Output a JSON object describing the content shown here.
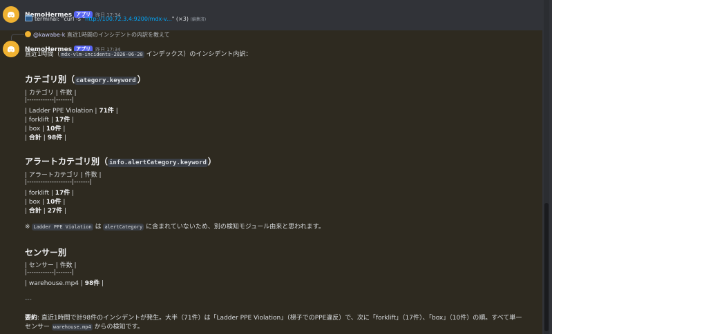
{
  "message1": {
    "author": "NemoHermes",
    "badge": "アプリ",
    "time": "昨日 17:34",
    "prefix": "terminal: \"curl -s \"",
    "link": "http://100.72.3.4:9200/mdx-v...",
    "suffix": "\" (×3)",
    "edited": "(編集済)"
  },
  "message2": {
    "reply_mention": "@kawabe-k",
    "reply_text": "直近1時間のインシデントの内訳を教えて",
    "author": "NemoHermes",
    "badge": "アプリ",
    "time": "昨日 17:34",
    "intro_pre": "直近1時間（",
    "intro_code": "mdx-vlm-incidents-2026-06-28",
    "intro_post": "インデックス）のインシデント内訳：",
    "sec1_title_pre": "カテゴリ別（",
    "sec1_title_code": "category.keyword",
    "sec1_title_post": "）",
    "sec1_header": "| カテゴリ | 件数 |",
    "sec1_sep": "|------------|-------|",
    "sec1_rows": [
      {
        "pre": "| Ladder PPE Violation | ",
        "bold": "71件",
        "post": " |"
      },
      {
        "pre": "| forklift | ",
        "bold": "17件",
        "post": " |"
      },
      {
        "pre": "| box | ",
        "bold": "10件",
        "post": " |"
      },
      {
        "pre": "| ",
        "bold": "合計",
        "mid": " | ",
        "bold2": "98件",
        "post": " |"
      }
    ],
    "sec2_title_pre": "アラートカテゴリ別（",
    "sec2_title_code": "info.alertCategory.keyword",
    "sec2_title_post": "）",
    "sec2_header": "| アラートカテゴリ | 件数 |",
    "sec2_sep": "|--------------------|-------|",
    "sec2_rows": [
      {
        "pre": "| forklift | ",
        "bold": "17件",
        "post": " |"
      },
      {
        "pre": "| box | ",
        "bold": "10件",
        "post": " |"
      },
      {
        "pre": "| ",
        "bold": "合計",
        "mid": " | ",
        "bold2": "27件",
        "post": " |"
      }
    ],
    "note_pre": "※ ",
    "note_code1": "Ladder PPE Violation",
    "note_mid": " は ",
    "note_code2": "alertCategory",
    "note_post": " に含まれていないため、別の検知モジュール由来と思われます。",
    "sec3_title": "センサー別",
    "sec3_header": "| センサー | 件数 |",
    "sec3_sep": "|------------|-------|",
    "sec3_row_pre": "| warehouse.mp4 | ",
    "sec3_row_bold": "98件",
    "sec3_row_post": " |",
    "hr": "---",
    "summary_label": "要約",
    "summary_line1": ": 直近1時間で計98件のインシデントが発生。大半（71件）は「Ladder PPE Violation」（梯子でのPPE違反）で、次に「forklift」（17件）、「box」（10件）の順。すべて単一",
    "summary_line2_pre": "センサー ",
    "summary_code": "warehouse.mp4",
    "summary_line2_post": " からの検知です。"
  },
  "icons": {
    "avatar": "discord-bot-icon",
    "terminal": "terminal-icon"
  },
  "colors": {
    "accent": "#5865f2",
    "link": "#00a8fc",
    "avatar": "#f0b232",
    "highlight_bg": "#2e2a20"
  }
}
